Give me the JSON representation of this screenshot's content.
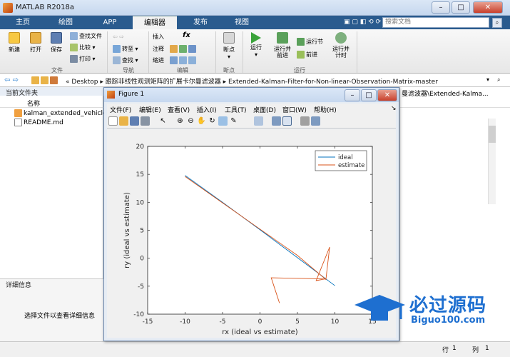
{
  "window": {
    "title": "MATLAB R2018a"
  },
  "tabs": [
    "主页",
    "绘图",
    "APP",
    "编辑器",
    "发布",
    "视图"
  ],
  "active_tab": "编辑器",
  "search": {
    "placeholder": "搜索文档"
  },
  "ribbon": {
    "file": {
      "new": "新建",
      "open": "打开",
      "save": "保存",
      "find_files": "查找文件",
      "compare": "比较",
      "print": "打印",
      "group": "文件"
    },
    "navigate": {
      "goto": "转至",
      "find": "查找",
      "group": "导航"
    },
    "edit": {
      "insert": "插入",
      "comment": "注释",
      "indent": "缩进",
      "fx": "fx",
      "group": "编辑"
    },
    "breakpoints": {
      "label": "断点",
      "group": "断点"
    },
    "run": {
      "run": "运行",
      "run_advance": "运行并\n前进",
      "run_section": "运行节",
      "advance": "前进",
      "run_time": "运行并\n计时",
      "group": "运行"
    }
  },
  "address": {
    "path": "« Desktop ▸ 跟踪非线性观测矩阵的扩展卡尔曼滤波器 ▸ Extended-Kalman-Filter-for-Non-linear-Observation-Matrix-master",
    "right_fragment": "曼滤波器\\Extended-Kalma..."
  },
  "file_panel": {
    "title": "当前文件夹",
    "column": "名称",
    "files": [
      {
        "name": "kalman_extended_vehicle",
        "icon": "m-file-icon"
      },
      {
        "name": "README.md",
        "icon": "text-file-icon"
      }
    ]
  },
  "detail_panel": {
    "title": "详细信息",
    "message": "选择文件以查看详细信息"
  },
  "status": {
    "row_label": "行",
    "row": "1",
    "col_label": "列",
    "col": "1"
  },
  "figure": {
    "title": "Figure 1",
    "menus": [
      "文件(F)",
      "编辑(E)",
      "查看(V)",
      "插入(I)",
      "工具(T)",
      "桌面(D)",
      "窗口(W)",
      "帮助(H)"
    ]
  },
  "chart_data": {
    "type": "line",
    "title": "",
    "xlabel": "rx (ideal vs estimate)",
    "ylabel": "ry (ideal vs estimate)",
    "xlim": [
      -15,
      15
    ],
    "ylim": [
      -10,
      20
    ],
    "xticks": [
      -15,
      -10,
      -5,
      0,
      5,
      10,
      15
    ],
    "yticks": [
      -10,
      -5,
      0,
      5,
      10,
      15,
      20
    ],
    "legend_position": "top-right",
    "series": [
      {
        "name": "ideal",
        "color": "#0072bd",
        "x": [
          -10,
          -5,
          0,
          5,
          10
        ],
        "y": [
          14.8,
          10.0,
          5.1,
          0.1,
          -4.9
        ]
      },
      {
        "name": "estimate",
        "color": "#d95319",
        "x": [
          -10,
          -5,
          0,
          5,
          8.8,
          9.3,
          7.5,
          8.7,
          1.5,
          2.6
        ],
        "y": [
          14.6,
          9.9,
          5.2,
          0.5,
          -3.8,
          2.0,
          -4.0,
          -3.7,
          -3.5,
          -8.0
        ]
      }
    ]
  },
  "watermark": {
    "cn": "必过源码",
    "url": "Biguo100.com"
  },
  "colors": {
    "tab_bar": "#2a5b8e",
    "ideal": "#0072bd",
    "estimate": "#d95319"
  }
}
